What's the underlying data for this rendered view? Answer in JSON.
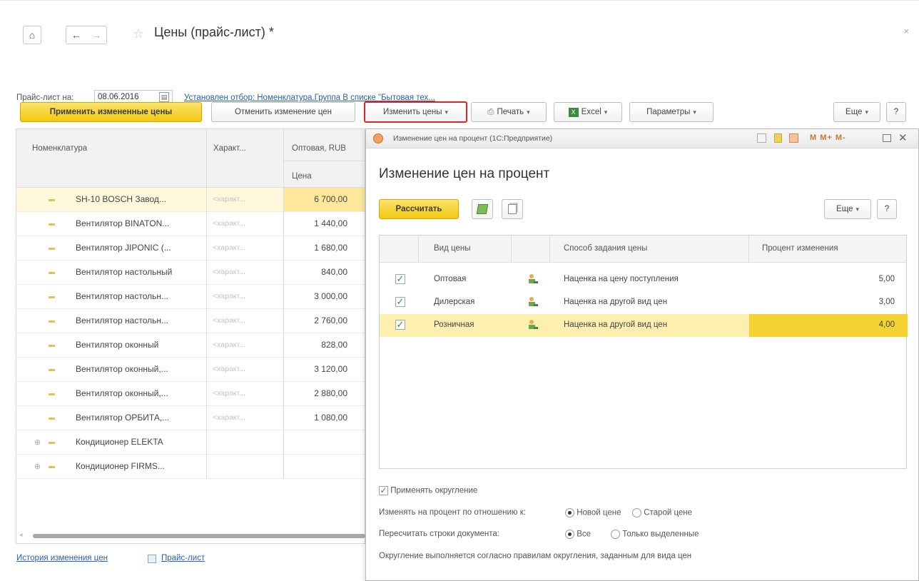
{
  "window": {
    "title": "Цены (прайс-лист) *",
    "close_glyph": "×"
  },
  "filter": {
    "label": "Прайс-лист на:",
    "date": "08.06.2016",
    "filter_link": "Установлен отбор: Номенклатура.Группа В списке \"Бытовая тех..."
  },
  "toolbar": {
    "apply": "Применить измененные цены",
    "cancel": "Отменить изменение цен",
    "change_prices": "Изменить цены",
    "print": "Печать",
    "excel": "Excel",
    "params": "Параметры",
    "more": "Еще",
    "help": "?"
  },
  "grid": {
    "headers": {
      "nomenclature": "Номенклатура",
      "characteristic": "Характ...",
      "wholesale": "Оптовая, RUB",
      "price": "Цена"
    },
    "rows": [
      {
        "name": "SH-10 BOSCH Завод...",
        "char": "<характ...",
        "price": "6 700,00"
      },
      {
        "name": "Вентилятор BINATON...",
        "char": "<характ...",
        "price": "1 440,00"
      },
      {
        "name": "Вентилятор JIPONIC (...",
        "char": "<характ...",
        "price": "1 680,00"
      },
      {
        "name": "Вентилятор настольный",
        "char": "<характ...",
        "price": "840,00"
      },
      {
        "name": "Вентилятор настольн...",
        "char": "<характ...",
        "price": "3 000,00"
      },
      {
        "name": "Вентилятор настольн...",
        "char": "<характ...",
        "price": "2 760,00"
      },
      {
        "name": "Вентилятор оконный",
        "char": "<характ...",
        "price": "828,00"
      },
      {
        "name": "Вентилятор оконный,...",
        "char": "<характ...",
        "price": "3 120,00"
      },
      {
        "name": "Вентилятор оконный,...",
        "char": "<характ...",
        "price": "2 880,00"
      },
      {
        "name": "Вентилятор ОРБИТА,...",
        "char": "<характ...",
        "price": "1 080,00"
      },
      {
        "name": "Кондиционер ELEKTA",
        "char": "",
        "price": ""
      },
      {
        "name": "Кондиционер FIRMS...",
        "char": "",
        "price": ""
      }
    ]
  },
  "bottom_links": {
    "history": "История изменения цен",
    "pricelist": "Прайс-лист"
  },
  "dialog": {
    "window_title": "Изменение цен на процент  (1С:Предприятие)",
    "titlebar_tools": "M  M+  M-",
    "heading": "Изменение цен на процент",
    "calculate": "Рассчитать",
    "more": "Еще",
    "help": "?",
    "headers": {
      "price_type": "Вид цены",
      "method": "Способ задания цены",
      "percent": "Процент изменения"
    },
    "rows": [
      {
        "checked": "✓",
        "type": "Оптовая",
        "method": "Наценка на цену поступления",
        "percent": "5,00"
      },
      {
        "checked": "✓",
        "type": "Дилерская",
        "method": "Наценка на другой вид цен",
        "percent": "3,00"
      },
      {
        "checked": "✓",
        "type": "Розничная",
        "method": "Наценка на другой вид цен",
        "percent": "4,00"
      }
    ],
    "rounding_check": "✓",
    "rounding_label": "Применять округление",
    "relative_label": "Изменять на процент по отношению к:",
    "relative_new": "Новой цене",
    "relative_old": "Старой цене",
    "recalc_label": "Пересчитать строки документа:",
    "recalc_all": "Все",
    "recalc_selected": "Только выделенные",
    "note": "Округление выполняется согласно правилам округления, заданным для вида цен"
  }
}
